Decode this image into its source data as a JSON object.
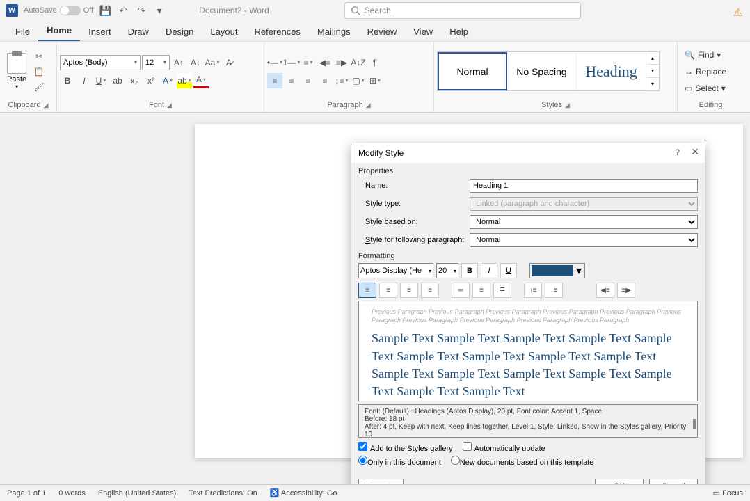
{
  "titlebar": {
    "autosave_label": "AutoSave",
    "autosave_state": "Off",
    "doc_title": "Document2 - Word",
    "search_placeholder": "Search"
  },
  "tabs": [
    "File",
    "Home",
    "Insert",
    "Draw",
    "Design",
    "Layout",
    "References",
    "Mailings",
    "Review",
    "View",
    "Help"
  ],
  "ribbon": {
    "clipboard": {
      "label": "Clipboard",
      "paste": "Paste"
    },
    "font": {
      "label": "Font",
      "font_name": "Aptos (Body)",
      "font_size": "12"
    },
    "paragraph": {
      "label": "Paragraph"
    },
    "styles": {
      "label": "Styles",
      "items": [
        "Normal",
        "No Spacing",
        "Heading"
      ]
    },
    "editing": {
      "label": "Editing",
      "find": "Find",
      "replace": "Replace",
      "select": "Select"
    }
  },
  "dialog": {
    "title": "Modify Style",
    "properties_label": "Properties",
    "name_label": "Name:",
    "name_value": "Heading 1",
    "type_label": "Style type:",
    "type_value": "Linked (paragraph and character)",
    "based_label": "Style based on:",
    "based_value": "Normal",
    "following_label": "Style for following paragraph:",
    "following_value": "Normal",
    "formatting_label": "Formatting",
    "fmt_font": "Aptos Display (He",
    "fmt_size": "20",
    "prev_para": "Previous Paragraph Previous Paragraph Previous Paragraph Previous Paragraph Previous Paragraph Previous Paragraph Previous Paragraph Previous Paragraph Previous Paragraph Previous Paragraph",
    "sample": "Sample Text Sample Text Sample Text Sample Text Sample Text Sample Text Sample Text Sample Text Sample Text Sample Text Sample Text Sample Text Sample Text Sample Text Sample Text Sample Text",
    "desc_line1": "Font: (Default) +Headings (Aptos Display), 20 pt, Font color: Accent 1, Space",
    "desc_line2": "    Before:  18 pt",
    "desc_line3": "    After:  4 pt, Keep with next, Keep lines together, Level 1, Style: Linked, Show in the Styles gallery, Priority: 10",
    "add_gallery": "Add to the Styles gallery",
    "auto_update": "Automatically update",
    "only_doc": "Only in this document",
    "new_docs": "New documents based on this template",
    "format_btn": "Format",
    "ok": "OK",
    "cancel": "Cancel"
  },
  "statusbar": {
    "page": "Page 1 of 1",
    "words": "0 words",
    "lang": "English (United States)",
    "predictions": "Text Predictions: On",
    "accessibility": "Accessibility: Go",
    "focus": "Focus"
  },
  "colors": {
    "accent1": "#1f4e79"
  }
}
